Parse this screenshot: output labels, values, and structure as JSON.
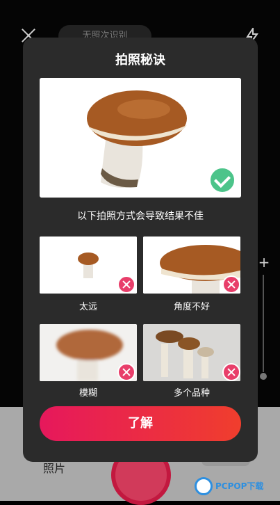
{
  "background": {
    "pill_text": "无照次识别",
    "photo_label": "照片",
    "watermark": "PCPOP下载"
  },
  "modal": {
    "title": "拍照秘诀",
    "hint": "以下拍照方式会导致结果不佳",
    "tiles": [
      {
        "label": "太远"
      },
      {
        "label": "角度不好"
      },
      {
        "label": "模糊"
      },
      {
        "label": "多个品种"
      }
    ],
    "button_label": "了解"
  },
  "colors": {
    "accent_gradient_start": "#e6185c",
    "accent_gradient_end": "#f03e2d",
    "ok_green": "#4cc48a",
    "bad_pink": "#e83e6a"
  }
}
